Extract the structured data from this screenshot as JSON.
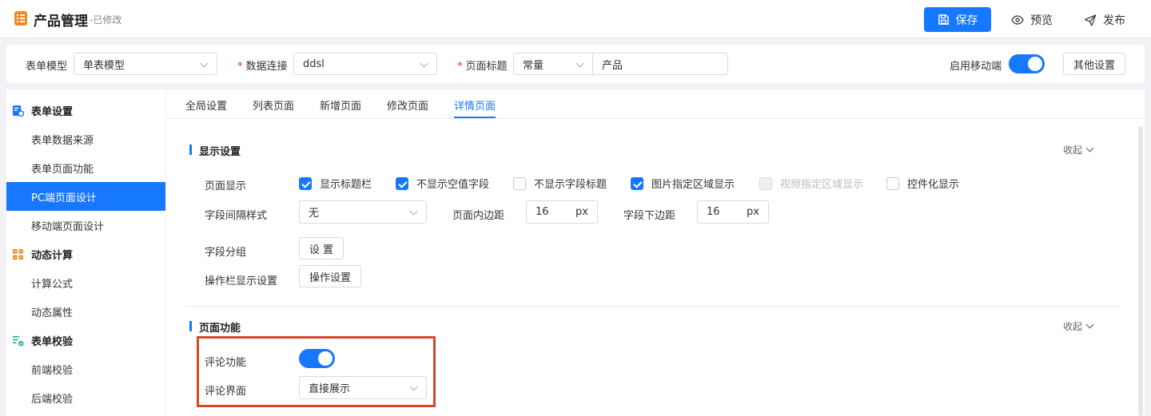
{
  "header": {
    "title": "产品管理",
    "status": "-已修改",
    "save_label": "保存",
    "preview_label": "预览",
    "publish_label": "发布"
  },
  "config": {
    "form_model_label": "表单模型",
    "form_model_value": "单表模型",
    "data_conn_label": "数据连接",
    "data_conn_value": "ddsl",
    "page_title_label": "页面标题",
    "page_title_type": "常量",
    "page_title_value": "产品",
    "mobile_label": "启用移动端",
    "mobile_enabled": true,
    "other_settings": "其他设置"
  },
  "sidebar": {
    "groups": [
      {
        "label": "表单设置",
        "icon": "form-settings-icon",
        "items": [
          "表单数据来源",
          "表单页面功能",
          "PC端页面设计",
          "移动端页面设计"
        ]
      },
      {
        "label": "动态计算",
        "icon": "calculator-icon",
        "items": [
          "计算公式",
          "动态属性"
        ]
      },
      {
        "label": "表单校验",
        "icon": "validate-icon",
        "items": [
          "前端校验",
          "后端校验"
        ]
      }
    ],
    "active_item": "PC端页面设计"
  },
  "tabs": [
    "全局设置",
    "列表页面",
    "新增页面",
    "修改页面",
    "详情页面"
  ],
  "active_tab": "详情页面",
  "display": {
    "title": "显示设置",
    "collapse_label": "收起",
    "page_display_label": "页面显示",
    "options": [
      {
        "label": "显示标题栏",
        "checked": true,
        "disabled": false
      },
      {
        "label": "不显示空值字段",
        "checked": true,
        "disabled": false
      },
      {
        "label": "不显示字段标题",
        "checked": false,
        "disabled": false
      },
      {
        "label": "图片指定区域显示",
        "checked": true,
        "disabled": false
      },
      {
        "label": "视频指定区域显示",
        "checked": false,
        "disabled": true
      },
      {
        "label": "控件化显示",
        "checked": false,
        "disabled": false
      }
    ],
    "spacing_label": "字段间隔样式",
    "spacing_value": "无",
    "padding_label": "页面内边距",
    "padding_value": "16",
    "padding_unit": "px",
    "bottom_margin_label": "字段下边距",
    "bottom_margin_value": "16",
    "bottom_margin_unit": "px",
    "group_label": "字段分组",
    "group_button": "设 置",
    "toolbar_label": "操作栏显示设置",
    "toolbar_button": "操作设置"
  },
  "function": {
    "title": "页面功能",
    "collapse_label": "收起",
    "comment_label": "评论功能",
    "comment_enabled": true,
    "comment_ui_label": "评论界面",
    "comment_ui_value": "直接展示"
  }
}
